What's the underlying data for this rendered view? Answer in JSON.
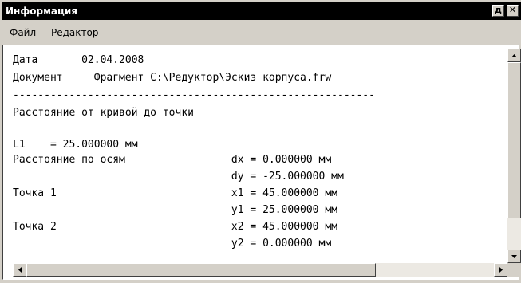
{
  "window": {
    "title": "Информация",
    "pin_glyph": "д",
    "close_glyph": "✕"
  },
  "menu": {
    "file": "Файл",
    "editor": "Редактор"
  },
  "content": {
    "lines": [
      "Дата       02.04.2008",
      "Документ     Фрагмент C:\\Редуктор\\Эскиз корпуса.frw",
      "----------------------------------------------------------",
      "Расстояние от кривой до точки",
      "",
      "L1    = 25.000000 мм",
      "Расстояние по осям                 dx = 0.000000 мм",
      "                                   dy = -25.000000 мм",
      "Точка 1                            x1 = 45.000000 мм",
      "                                   y1 = 25.000000 мм",
      "Точка 2                            x2 = 45.000000 мм",
      "                                   y2 = 0.000000 мм"
    ]
  },
  "colors": {
    "titlebar": "#000000",
    "face": "#d4d0c8",
    "content_bg": "#ffffff"
  }
}
